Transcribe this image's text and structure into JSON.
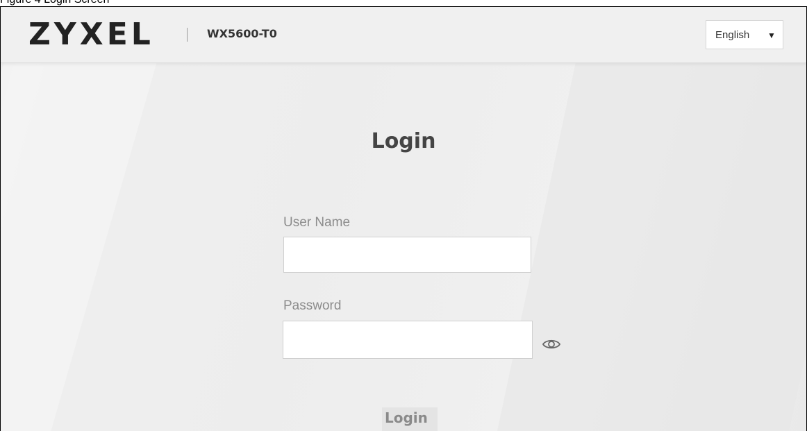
{
  "figure_caption": "Figure 4 Login Screen",
  "header": {
    "brand": "ZYXEL",
    "model": "WX5600-T0",
    "language": {
      "selected": "English",
      "caret_icon": "triangle-down-icon"
    }
  },
  "main": {
    "title": "Login",
    "username": {
      "label": "User Name",
      "value": ""
    },
    "password": {
      "label": "Password",
      "value": "",
      "toggle_icon": "eye-icon"
    },
    "login_button": "Login"
  }
}
